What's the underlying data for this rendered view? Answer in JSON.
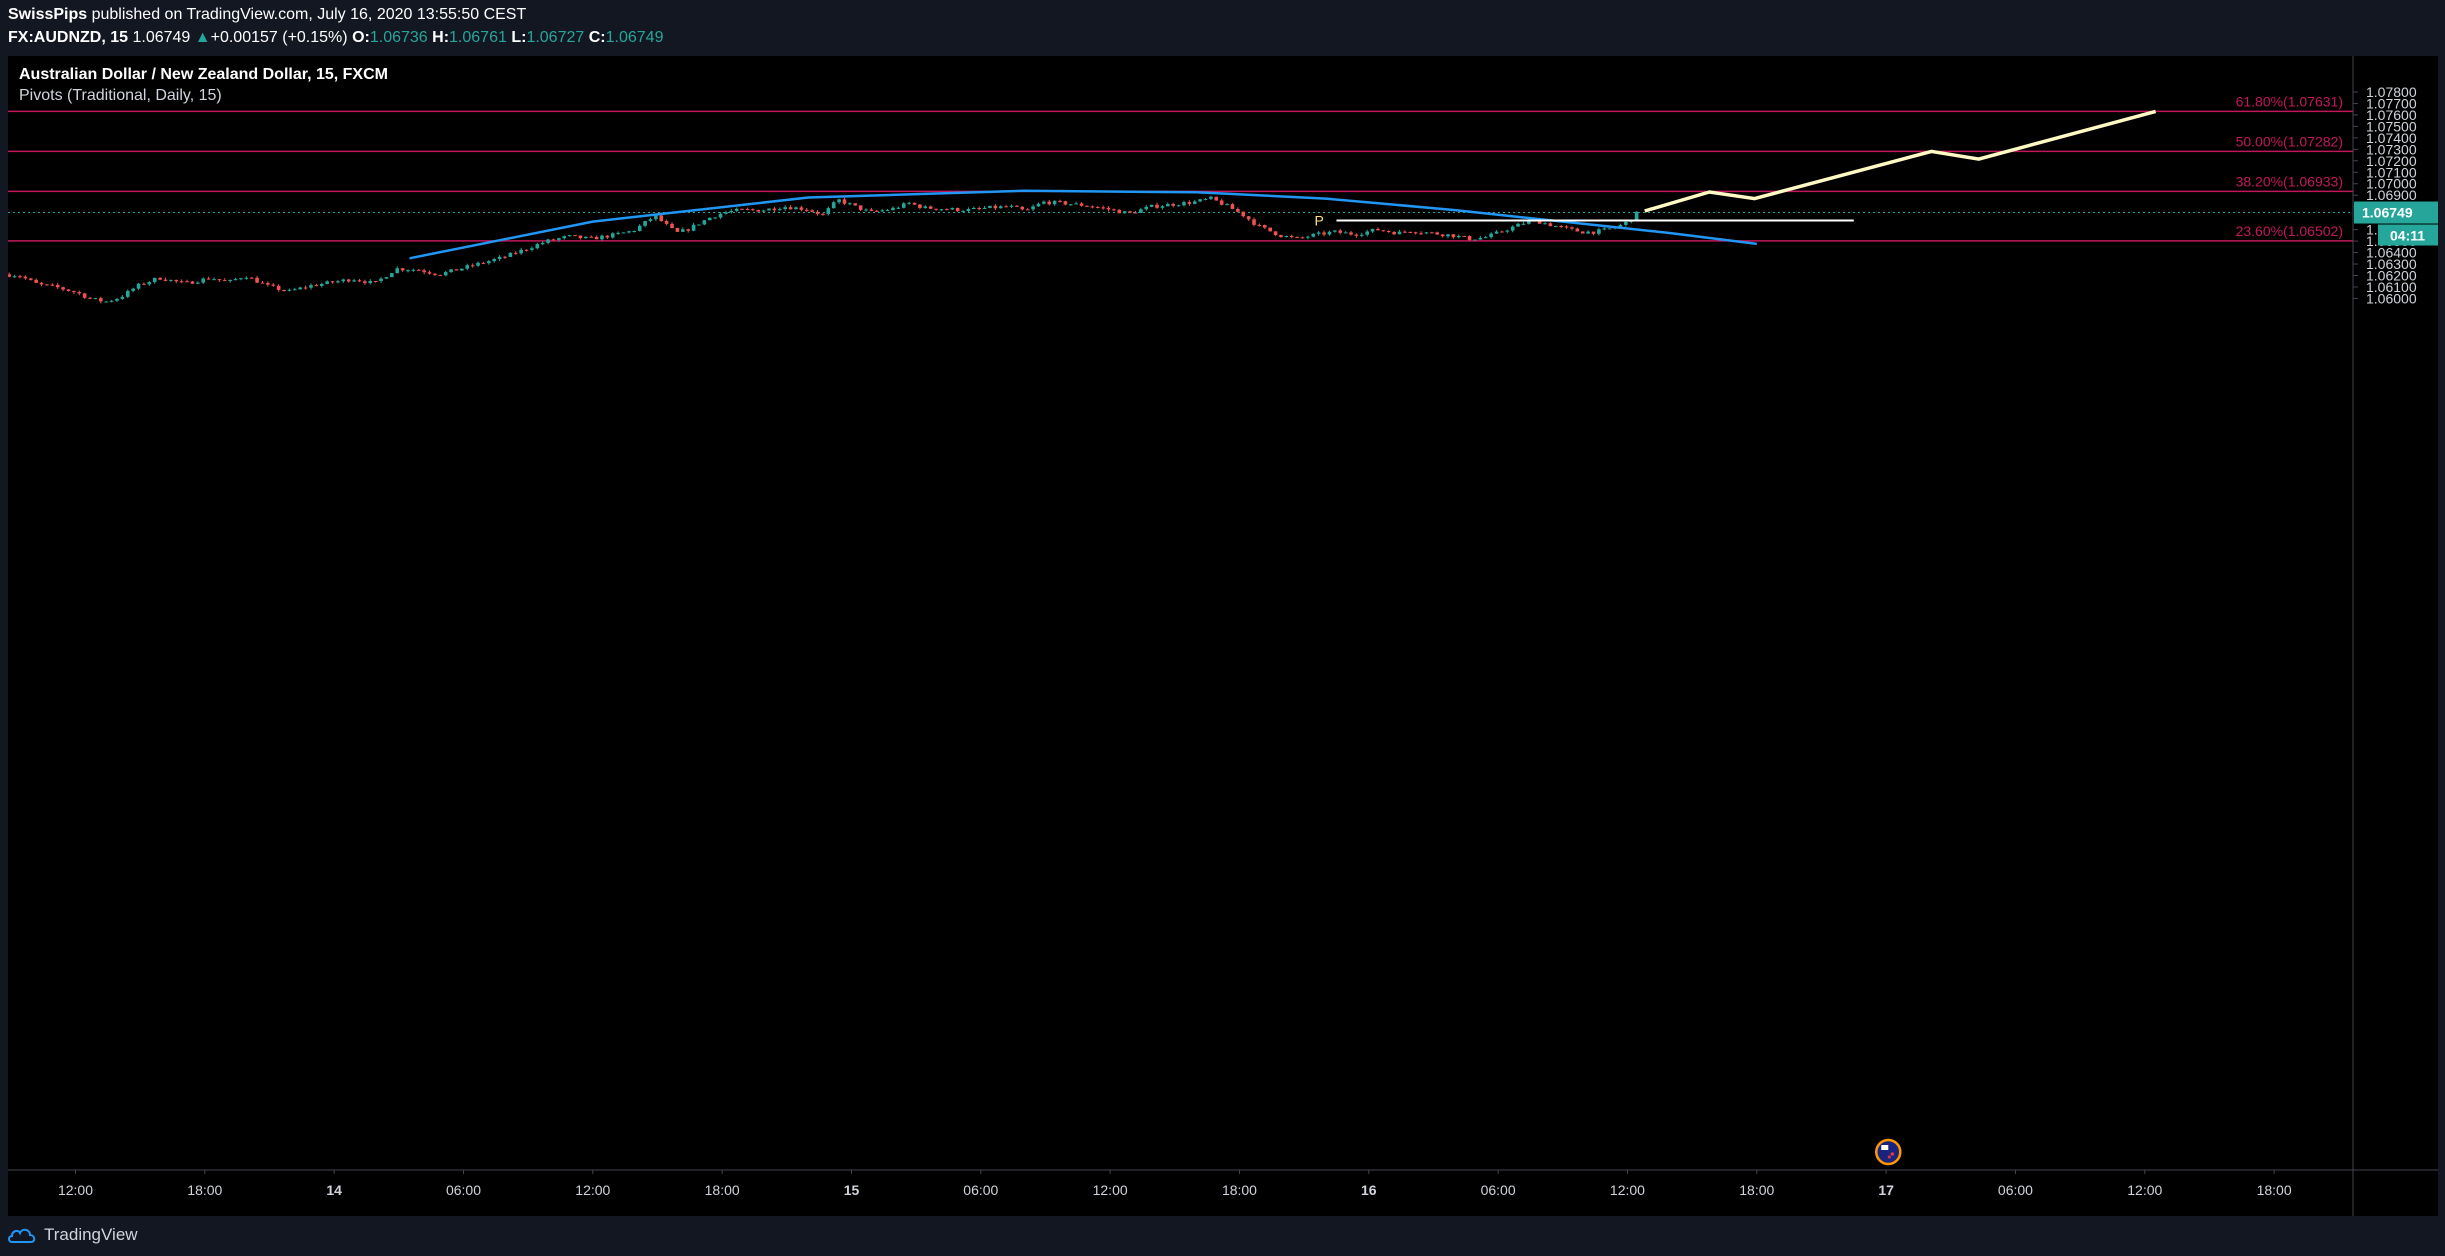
{
  "header": {
    "author": "SwissPips",
    "published_text": " published on TradingView.com, July 16, 2020 13:55:50 CEST",
    "symbol_label": "FX:AUDNZD, 15",
    "last_price": "1.06749",
    "change_arrow": "▲",
    "change_text": "+0.00157 (+0.15%)",
    "o_label": "O:",
    "o_value": "1.06736",
    "h_label": "H:",
    "h_value": "1.06761",
    "l_label": "L:",
    "l_value": "1.06727",
    "c_label": "C:",
    "c_value": "1.06749"
  },
  "legend": {
    "title": "Australian Dollar / New Zealand Dollar, 15, FXCM",
    "indicator": "Pivots (Traditional, Daily, 15)"
  },
  "footer": {
    "brand": "TradingView"
  },
  "colors": {
    "background": "#000000",
    "bull": "#26a69a",
    "bear": "#ef5350",
    "fib": "#c2185b",
    "arc": "#2196f3",
    "projection": "#fff9c4",
    "pivot": "#ffffff",
    "axis_text": "#d1d4dc"
  },
  "chart_data": {
    "type": "candlestick",
    "title": "Australian Dollar / New Zealand Dollar, 15, FXCM",
    "ylim": [
      1.05955,
      1.07905
    ],
    "grid": false,
    "y_ticks": [
      "1.07800",
      "1.07700",
      "1.07600",
      "1.07500",
      "1.07400",
      "1.07300",
      "1.07200",
      "1.07100",
      "1.07000",
      "1.06900",
      "1.06800",
      "1.06600",
      "1.06500",
      "1.06400",
      "1.06300",
      "1.06200",
      "1.06100",
      "1.06000"
    ],
    "x_ticks": [
      {
        "t": 6,
        "label": "12:00"
      },
      {
        "t": 12,
        "label": "18:00"
      },
      {
        "t": 18,
        "label": "14",
        "bold": true
      },
      {
        "t": 24,
        "label": "06:00"
      },
      {
        "t": 30,
        "label": "12:00"
      },
      {
        "t": 36,
        "label": "18:00"
      },
      {
        "t": 42,
        "label": "15",
        "bold": true
      },
      {
        "t": 48,
        "label": "06:00"
      },
      {
        "t": 54,
        "label": "12:00"
      },
      {
        "t": 60,
        "label": "18:00"
      },
      {
        "t": 66,
        "label": "16",
        "bold": true
      },
      {
        "t": 72,
        "label": "06:00"
      },
      {
        "t": 78,
        "label": "12:00"
      },
      {
        "t": 84,
        "label": "18:00"
      },
      {
        "t": 90,
        "label": "17",
        "bold": true
      },
      {
        "t": 96,
        "label": "06:00"
      },
      {
        "t": 102,
        "label": "12:00"
      },
      {
        "t": 108,
        "label": "18:00"
      }
    ],
    "price_path": [
      [
        2.8,
        1.0621
      ],
      [
        3.5,
        1.062
      ],
      [
        4.4,
        1.0612
      ],
      [
        5.2,
        1.061
      ],
      [
        6.2,
        1.0605
      ],
      [
        6.8,
        1.06
      ],
      [
        7.5,
        1.0597
      ],
      [
        8.2,
        1.0601
      ],
      [
        9.0,
        1.0611
      ],
      [
        10.0,
        1.0618
      ],
      [
        11.2,
        1.0613
      ],
      [
        12.4,
        1.0618
      ],
      [
        13.2,
        1.0614
      ],
      [
        14.0,
        1.062
      ],
      [
        15.0,
        1.0611
      ],
      [
        16.0,
        1.0606
      ],
      [
        17.0,
        1.0611
      ],
      [
        18.0,
        1.0614
      ],
      [
        19.0,
        1.0617
      ],
      [
        20.0,
        1.0613
      ],
      [
        21.0,
        1.0626
      ],
      [
        22.0,
        1.0625
      ],
      [
        23.0,
        1.0621
      ],
      [
        24.0,
        1.0626
      ],
      [
        25.0,
        1.0631
      ],
      [
        26.0,
        1.0636
      ],
      [
        27.0,
        1.0643
      ],
      [
        28.0,
        1.065
      ],
      [
        29.0,
        1.0654
      ],
      [
        30.0,
        1.0652
      ],
      [
        31.0,
        1.0655
      ],
      [
        32.0,
        1.0659
      ],
      [
        33.0,
        1.0672
      ],
      [
        34.0,
        1.0657
      ],
      [
        34.5,
        1.066
      ],
      [
        35.5,
        1.067
      ],
      [
        36.2,
        1.0675
      ],
      [
        37.0,
        1.0677
      ],
      [
        38.0,
        1.0677
      ],
      [
        39.0,
        1.068
      ],
      [
        40.0,
        1.0678
      ],
      [
        40.8,
        1.0673
      ],
      [
        41.5,
        1.0686
      ],
      [
        42.3,
        1.068
      ],
      [
        43.0,
        1.0675
      ],
      [
        44.0,
        1.0678
      ],
      [
        44.8,
        1.0683
      ],
      [
        45.5,
        1.0679
      ],
      [
        46.5,
        1.0678
      ],
      [
        47.5,
        1.0677
      ],
      [
        48.5,
        1.0679
      ],
      [
        49.5,
        1.068
      ],
      [
        50.2,
        1.0676
      ],
      [
        51.0,
        1.0684
      ],
      [
        52.0,
        1.0683
      ],
      [
        53.0,
        1.0681
      ],
      [
        54.0,
        1.0678
      ],
      [
        55.0,
        1.0674
      ],
      [
        56.0,
        1.068
      ],
      [
        57.0,
        1.0682
      ],
      [
        58.0,
        1.0684
      ],
      [
        58.8,
        1.0687
      ],
      [
        59.5,
        1.0681
      ],
      [
        60.2,
        1.0674
      ],
      [
        61.0,
        1.0663
      ],
      [
        62.0,
        1.0655
      ],
      [
        62.8,
        1.0652
      ],
      [
        63.5,
        1.0655
      ],
      [
        64.5,
        1.0658
      ],
      [
        65.5,
        1.0656
      ],
      [
        66.5,
        1.066
      ],
      [
        67.5,
        1.0657
      ],
      [
        68.0,
        1.0659
      ],
      [
        69.0,
        1.0657
      ],
      [
        70.0,
        1.0655
      ],
      [
        70.8,
        1.0652
      ],
      [
        71.5,
        1.0653
      ],
      [
        72.5,
        1.066
      ],
      [
        73.5,
        1.0667
      ],
      [
        74.0,
        1.0667
      ],
      [
        75.0,
        1.0662
      ],
      [
        76.0,
        1.0658
      ],
      [
        76.6,
        1.0658
      ],
      [
        77.2,
        1.066
      ],
      [
        78.0,
        1.0665
      ],
      [
        78.5,
        1.0674
      ]
    ],
    "fibonacci": [
      {
        "level": "61.80%",
        "value": 1.07631,
        "label": "61.80%(1.07631)"
      },
      {
        "level": "50.00%",
        "value": 1.07282,
        "label": "50.00%(1.07282)"
      },
      {
        "level": "38.20%",
        "value": 1.06933,
        "label": "38.20%(1.06933)"
      },
      {
        "level": "23.60%",
        "value": 1.06502,
        "label": "23.60%(1.06502)"
      }
    ],
    "pivot": {
      "label": "P",
      "value": 1.06679,
      "t_start": 64.5,
      "t_end": 88.5
    },
    "arc": [
      [
        21.5,
        1.0635
      ],
      [
        30,
        1.0667
      ],
      [
        40,
        1.0688
      ],
      [
        50,
        1.06938
      ],
      [
        58,
        1.06925
      ],
      [
        64,
        1.0687
      ],
      [
        70,
        1.0677
      ],
      [
        76,
        1.0665
      ],
      [
        80,
        1.0657
      ],
      [
        84,
        1.06475
      ]
    ],
    "projection": [
      [
        78.8,
        1.06762
      ],
      [
        81.8,
        1.06928
      ],
      [
        83.9,
        1.0687
      ],
      [
        92.1,
        1.07282
      ],
      [
        94.3,
        1.07215
      ],
      [
        102.5,
        1.07631
      ]
    ],
    "current_price": {
      "value": 1.06749,
      "label": "1.06749"
    },
    "countdown": {
      "label": "04:11"
    }
  }
}
